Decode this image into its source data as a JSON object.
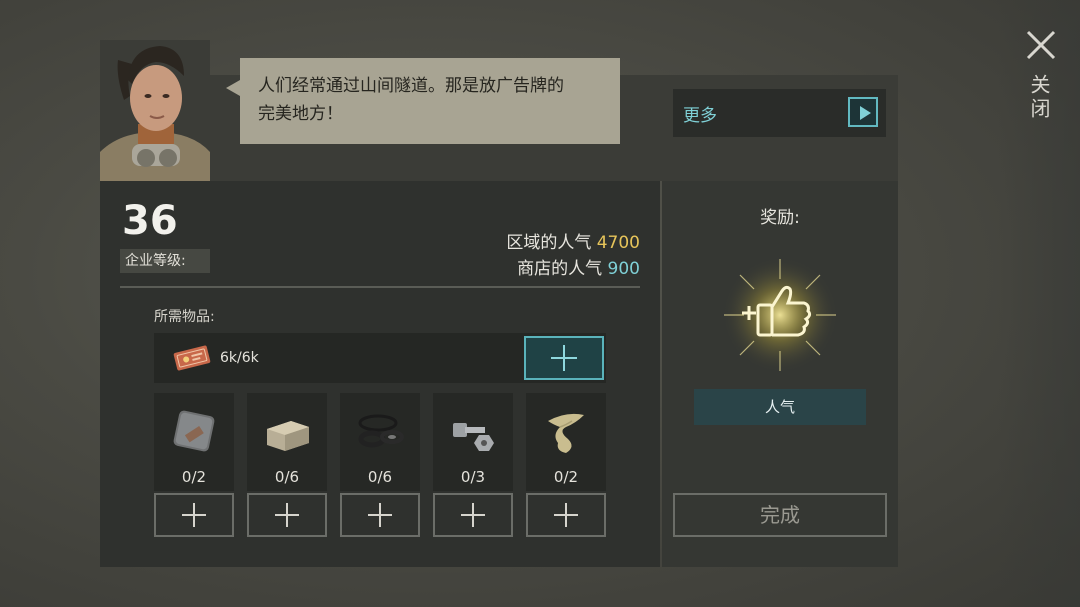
{
  "header": {
    "close_label": "关闭",
    "dialog_text_line1": "人们经常通过山间隧道。那是放广告牌的",
    "dialog_text_line2": "完美地方！",
    "more_label": "更多"
  },
  "company": {
    "level": "36",
    "level_label": "企业等级:",
    "area_popularity_label": "区域的人气",
    "area_popularity_value": "4700",
    "shop_popularity_label": "商店的人气",
    "shop_popularity_value": "900"
  },
  "requirements": {
    "label": "所需物品:",
    "coupon_count": "6k/6k",
    "materials": [
      {
        "icon": "metal-plate-icon",
        "count": "0/2"
      },
      {
        "icon": "stone-block-icon",
        "count": "0/6"
      },
      {
        "icon": "rubber-rings-icon",
        "count": "0/6"
      },
      {
        "icon": "bolt-nut-icon",
        "count": "0/3"
      },
      {
        "icon": "fabric-strip-icon",
        "count": "0/2"
      }
    ]
  },
  "reward": {
    "title": "奖励:",
    "icon": "thumbs-up-plus-icon",
    "type_label": "人气"
  },
  "actions": {
    "complete_label": "完成"
  },
  "colors": {
    "accent_cyan": "#7fd0d6",
    "gold": "#e6c45a"
  }
}
